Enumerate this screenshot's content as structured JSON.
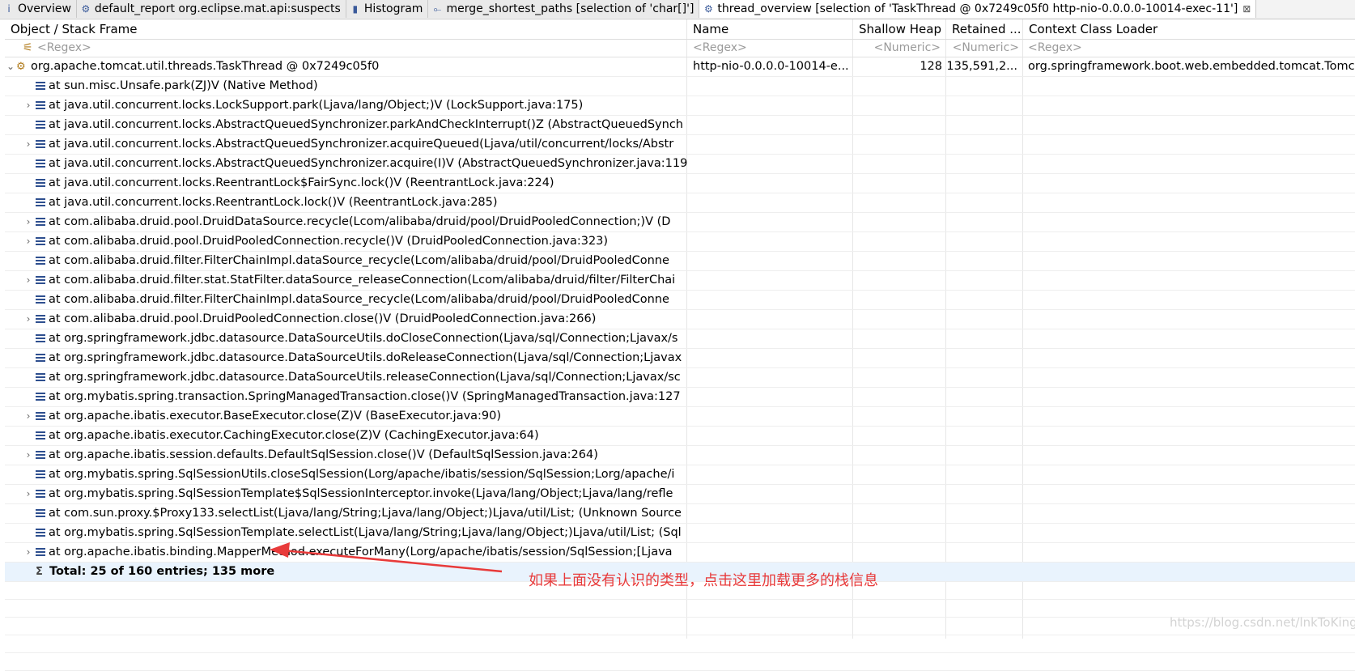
{
  "tabs": [
    {
      "icon": "info-icon",
      "glyph": "i",
      "label": "Overview"
    },
    {
      "icon": "report-icon",
      "glyph": "⚙",
      "label": "default_report  org.eclipse.mat.api:suspects"
    },
    {
      "icon": "histogram-icon",
      "glyph": "▮",
      "label": "Histogram"
    },
    {
      "icon": "merge-paths-icon",
      "glyph": "⟜",
      "label": "merge_shortest_paths  [selection of 'char[]']"
    },
    {
      "icon": "thread-icon",
      "glyph": "⚙",
      "label": "thread_overview  [selection of 'TaskThread @ 0x7249c05f0  http-nio-0.0.0.0-10014-exec-11']",
      "close": "⊠"
    }
  ],
  "table": {
    "columns": [
      "Object / Stack Frame",
      "Name",
      "Shallow Heap",
      "Retained ...",
      "Context Class Loader"
    ],
    "filters": [
      "<Regex>",
      "<Regex>",
      "<Numeric>",
      "<Numeric>",
      "<Regex>"
    ],
    "thread_row": {
      "object": "org.apache.tomcat.util.threads.TaskThread @ 0x7249c05f0",
      "name": "http-nio-0.0.0.0-10014-e...",
      "shallow": "128",
      "retained": "135,591,2...",
      "loader": "org.springframework.boot.web.embedded.tomcat.Tomc"
    },
    "frames": [
      {
        "text": "at sun.misc.Unsafe.park(ZJ)V (Native Method)",
        "expandable": false
      },
      {
        "text": "at java.util.concurrent.locks.LockSupport.park(Ljava/lang/Object;)V (LockSupport.java:175)",
        "expandable": true
      },
      {
        "text": "at java.util.concurrent.locks.AbstractQueuedSynchronizer.parkAndCheckInterrupt()Z (AbstractQueuedSynch",
        "expandable": false
      },
      {
        "text": "at java.util.concurrent.locks.AbstractQueuedSynchronizer.acquireQueued(Ljava/util/concurrent/locks/Abstr",
        "expandable": true
      },
      {
        "text": "at java.util.concurrent.locks.AbstractQueuedSynchronizer.acquire(I)V (AbstractQueuedSynchronizer.java:119",
        "expandable": false
      },
      {
        "text": "at java.util.concurrent.locks.ReentrantLock$FairSync.lock()V (ReentrantLock.java:224)",
        "expandable": false
      },
      {
        "text": "at java.util.concurrent.locks.ReentrantLock.lock()V (ReentrantLock.java:285)",
        "expandable": false
      },
      {
        "text": "at com.alibaba.druid.pool.DruidDataSource.recycle(Lcom/alibaba/druid/pool/DruidPooledConnection;)V (D",
        "expandable": true
      },
      {
        "text": "at com.alibaba.druid.pool.DruidPooledConnection.recycle()V (DruidPooledConnection.java:323)",
        "expandable": true
      },
      {
        "text": "at com.alibaba.druid.filter.FilterChainImpl.dataSource_recycle(Lcom/alibaba/druid/pool/DruidPooledConne",
        "expandable": false
      },
      {
        "text": "at com.alibaba.druid.filter.stat.StatFilter.dataSource_releaseConnection(Lcom/alibaba/druid/filter/FilterChai",
        "expandable": true
      },
      {
        "text": "at com.alibaba.druid.filter.FilterChainImpl.dataSource_recycle(Lcom/alibaba/druid/pool/DruidPooledConne",
        "expandable": false
      },
      {
        "text": "at com.alibaba.druid.pool.DruidPooledConnection.close()V (DruidPooledConnection.java:266)",
        "expandable": true
      },
      {
        "text": "at org.springframework.jdbc.datasource.DataSourceUtils.doCloseConnection(Ljava/sql/Connection;Ljavax/s",
        "expandable": false
      },
      {
        "text": "at org.springframework.jdbc.datasource.DataSourceUtils.doReleaseConnection(Ljava/sql/Connection;Ljavax",
        "expandable": false
      },
      {
        "text": "at org.springframework.jdbc.datasource.DataSourceUtils.releaseConnection(Ljava/sql/Connection;Ljavax/sc",
        "expandable": false
      },
      {
        "text": "at org.mybatis.spring.transaction.SpringManagedTransaction.close()V (SpringManagedTransaction.java:127",
        "expandable": false
      },
      {
        "text": "at org.apache.ibatis.executor.BaseExecutor.close(Z)V (BaseExecutor.java:90)",
        "expandable": true
      },
      {
        "text": "at org.apache.ibatis.executor.CachingExecutor.close(Z)V (CachingExecutor.java:64)",
        "expandable": false
      },
      {
        "text": "at org.apache.ibatis.session.defaults.DefaultSqlSession.close()V (DefaultSqlSession.java:264)",
        "expandable": true
      },
      {
        "text": "at org.mybatis.spring.SqlSessionUtils.closeSqlSession(Lorg/apache/ibatis/session/SqlSession;Lorg/apache/i",
        "expandable": false
      },
      {
        "text": "at org.mybatis.spring.SqlSessionTemplate$SqlSessionInterceptor.invoke(Ljava/lang/Object;Ljava/lang/refle",
        "expandable": true
      },
      {
        "text": "at com.sun.proxy.$Proxy133.selectList(Ljava/lang/String;Ljava/lang/Object;)Ljava/util/List; (Unknown Source",
        "expandable": false
      },
      {
        "text": "at org.mybatis.spring.SqlSessionTemplate.selectList(Ljava/lang/String;Ljava/lang/Object;)Ljava/util/List; (Sql",
        "expandable": false
      },
      {
        "text": "at org.apache.ibatis.binding.MapperMethod.executeForMany(Lorg/apache/ibatis/session/SqlSession;[Ljava",
        "expandable": true
      }
    ],
    "total_label": "Total: 25 of 160 entries; 135 more"
  },
  "annotation": {
    "text": "如果上面没有认识的类型，点击这里加载更多的栈信息",
    "color": "#e83a3a"
  },
  "watermark": "https://blog.csdn.net/lnkToKing",
  "colors": {
    "selected_row": "#e9f3fd",
    "frame_icon": "#2e4f8f",
    "annotation": "#e83a3a"
  }
}
